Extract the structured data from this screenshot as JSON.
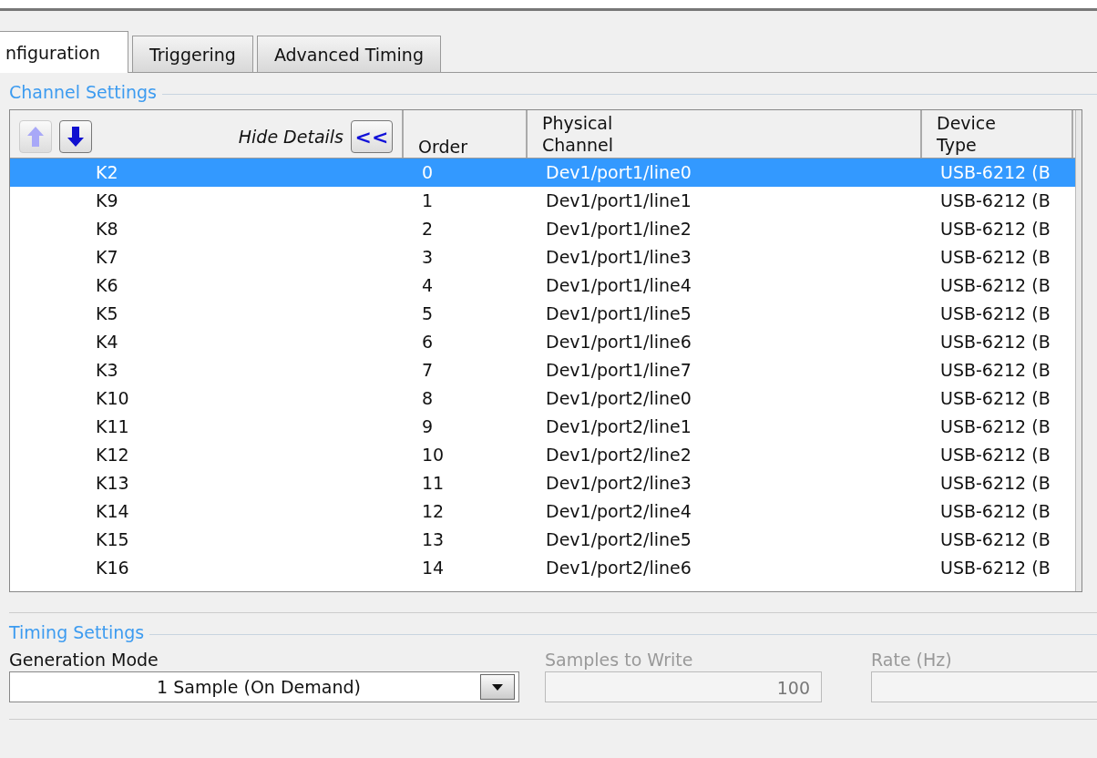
{
  "tabs": [
    {
      "label": "nfiguration",
      "selected": true
    },
    {
      "label": "Triggering",
      "selected": false
    },
    {
      "label": "Advanced Timing",
      "selected": false
    }
  ],
  "channel_settings": {
    "title": "Channel Settings",
    "move_up": {
      "disabled": true
    },
    "move_down": {
      "disabled": false
    },
    "hide_details": {
      "label": "Hide Details",
      "button": "<<"
    },
    "columns": [
      "Order",
      "Physical\nChannel",
      "Device\nType"
    ],
    "rows": [
      {
        "name": "K2",
        "order": "0",
        "channel": "Dev1/port1/line0",
        "device": "USB-6212 (B",
        "selected": true
      },
      {
        "name": "K9",
        "order": "1",
        "channel": "Dev1/port1/line1",
        "device": "USB-6212 (B",
        "selected": false
      },
      {
        "name": "K8",
        "order": "2",
        "channel": "Dev1/port1/line2",
        "device": "USB-6212 (B",
        "selected": false
      },
      {
        "name": "K7",
        "order": "3",
        "channel": "Dev1/port1/line3",
        "device": "USB-6212 (B",
        "selected": false
      },
      {
        "name": "K6",
        "order": "4",
        "channel": "Dev1/port1/line4",
        "device": "USB-6212 (B",
        "selected": false
      },
      {
        "name": "K5",
        "order": "5",
        "channel": "Dev1/port1/line5",
        "device": "USB-6212 (B",
        "selected": false
      },
      {
        "name": "K4",
        "order": "6",
        "channel": "Dev1/port1/line6",
        "device": "USB-6212 (B",
        "selected": false
      },
      {
        "name": "K3",
        "order": "7",
        "channel": "Dev1/port1/line7",
        "device": "USB-6212 (B",
        "selected": false
      },
      {
        "name": "K10",
        "order": "8",
        "channel": "Dev1/port2/line0",
        "device": "USB-6212 (B",
        "selected": false
      },
      {
        "name": "K11",
        "order": "9",
        "channel": "Dev1/port2/line1",
        "device": "USB-6212 (B",
        "selected": false
      },
      {
        "name": "K12",
        "order": "10",
        "channel": "Dev1/port2/line2",
        "device": "USB-6212 (B",
        "selected": false
      },
      {
        "name": "K13",
        "order": "11",
        "channel": "Dev1/port2/line3",
        "device": "USB-6212 (B",
        "selected": false
      },
      {
        "name": "K14",
        "order": "12",
        "channel": "Dev1/port2/line4",
        "device": "USB-6212 (B",
        "selected": false
      },
      {
        "name": "K15",
        "order": "13",
        "channel": "Dev1/port2/line5",
        "device": "USB-6212 (B",
        "selected": false
      },
      {
        "name": "K16",
        "order": "14",
        "channel": "Dev1/port2/line6",
        "device": "USB-6212 (B",
        "selected": false
      }
    ]
  },
  "timing_settings": {
    "title": "Timing Settings",
    "fields": [
      {
        "kind": "dropdown",
        "label": "Generation Mode",
        "value": "1 Sample (On Demand)",
        "disabled": false
      },
      {
        "kind": "number",
        "label": "Samples to Write",
        "value": "100",
        "disabled": true
      },
      {
        "kind": "number",
        "label": "Rate (Hz)",
        "disabled": true
      }
    ]
  }
}
